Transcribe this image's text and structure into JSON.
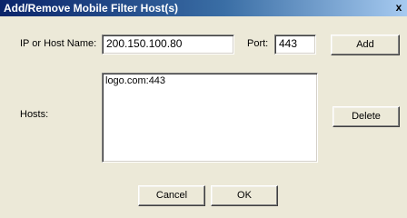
{
  "window": {
    "title": "Add/Remove Mobile Filter Host(s)",
    "close_glyph": "x"
  },
  "form": {
    "ip_label": "IP or Host Name:",
    "ip_value": "200.150.100.80",
    "port_label": "Port:",
    "port_value": "443",
    "hosts_label": "Hosts:",
    "hosts": [
      "logo.com:443"
    ]
  },
  "buttons": {
    "add": "Add",
    "delete": "Delete",
    "cancel": "Cancel",
    "ok": "OK"
  }
}
